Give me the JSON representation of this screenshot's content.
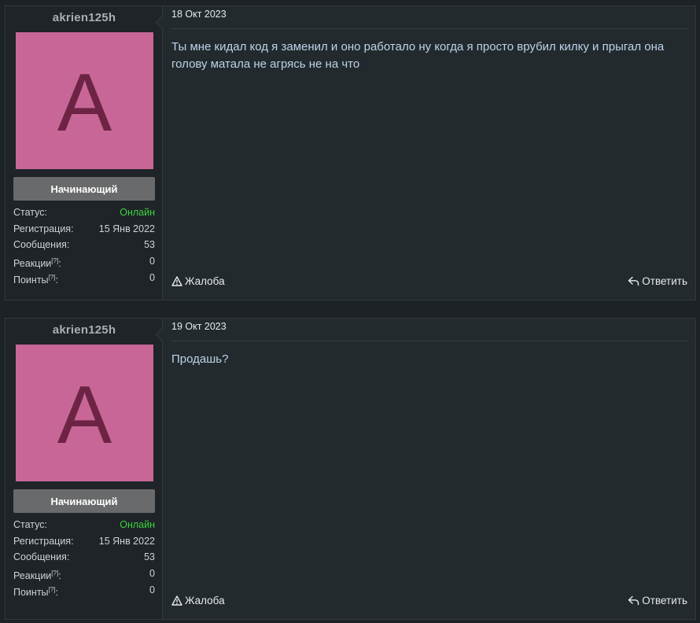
{
  "posts": [
    {
      "username": "akrien125h",
      "avatar_letter": "A",
      "avatar_color": "#c86797",
      "avatar_letter_color": "#6d2444",
      "rank": "Начинающий",
      "stats": {
        "status_label": "Статус:",
        "status_value": "Онлайн",
        "registration_label": "Регистрация:",
        "registration_value": "15 Янв 2022",
        "messages_label": "Сообщения:",
        "messages_value": "53",
        "reactions_label": "Реакции",
        "reactions_hint": "[?]",
        "reactions_colon": ":",
        "reactions_value": "0",
        "points_label": "Поинты",
        "points_hint": "[?]",
        "points_colon": ":",
        "points_value": "0"
      },
      "date": "18 Окт 2023",
      "message": "Ты мне кидал код я заменил и оно работало ну когда я просто врубил килку и прыгал она голову матала не агрясь не на что",
      "report_label": "Жалоба",
      "reply_label": "Ответить"
    },
    {
      "username": "akrien125h",
      "avatar_letter": "A",
      "avatar_color": "#c86797",
      "avatar_letter_color": "#6d2444",
      "rank": "Начинающий",
      "stats": {
        "status_label": "Статус:",
        "status_value": "Онлайн",
        "registration_label": "Регистрация:",
        "registration_value": "15 Янв 2022",
        "messages_label": "Сообщения:",
        "messages_value": "53",
        "reactions_label": "Реакции",
        "reactions_hint": "[?]",
        "reactions_colon": ":",
        "reactions_value": "0",
        "points_label": "Поинты",
        "points_hint": "[?]",
        "points_colon": ":",
        "points_value": "0"
      },
      "date": "19 Окт 2023",
      "message": "Продашь?",
      "report_label": "Жалоба",
      "reply_label": "Ответить"
    }
  ],
  "icons": {
    "report": "warning-triangle-icon",
    "reply": "reply-arrow-icon"
  },
  "colors": {
    "online": "#3cd33c",
    "message_text": "#bcd3e9"
  }
}
